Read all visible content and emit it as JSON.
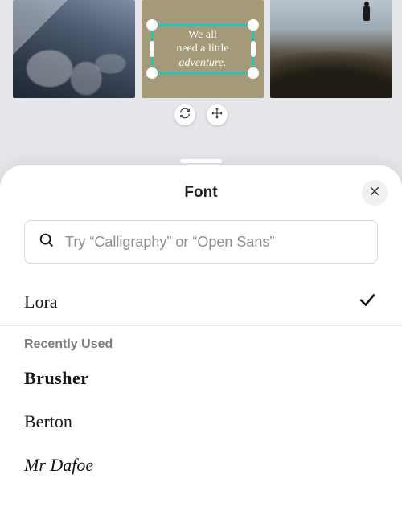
{
  "canvas": {
    "text_lines": [
      "We all",
      "need a little",
      "adventure."
    ],
    "selection_color": "#00d1d1",
    "tile_bg": "#a59a78"
  },
  "toolbar": {
    "sync_icon": "sync-icon",
    "move_icon": "move-icon"
  },
  "sheet": {
    "title": "Font",
    "close_icon": "close-icon",
    "search": {
      "placeholder": "Try “Calligraphy” or “Open Sans”",
      "value": "",
      "icon": "search-icon"
    },
    "selected_font": {
      "name": "Lora"
    },
    "recent_label": "Recently Used",
    "recent": [
      {
        "name": "Brusher",
        "style_class": "font-brusher"
      },
      {
        "name": "Berton",
        "style_class": "font-berton"
      },
      {
        "name": "Mr Dafoe",
        "style_class": "font-mrdafoe"
      }
    ]
  }
}
